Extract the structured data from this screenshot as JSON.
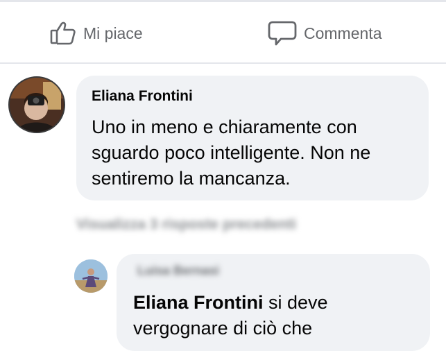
{
  "actions": {
    "like_label": "Mi piace",
    "comment_label": "Commenta"
  },
  "comment": {
    "author": "Eliana Frontini",
    "text": "Uno in meno e chiaramente con sguardo poco intelligente. Non ne sentiremo la mancanza."
  },
  "view_previous_replies": "Visualizza 3 risposte precedenti",
  "reply": {
    "author": "Luisa Bernasi",
    "mention": "Eliana Frontini",
    "text_after_mention": " si deve vergognare di ciò che"
  },
  "colors": {
    "bubble": "#f0f2f5",
    "muted_text": "#65676b",
    "divider": "#e4e6eb"
  }
}
